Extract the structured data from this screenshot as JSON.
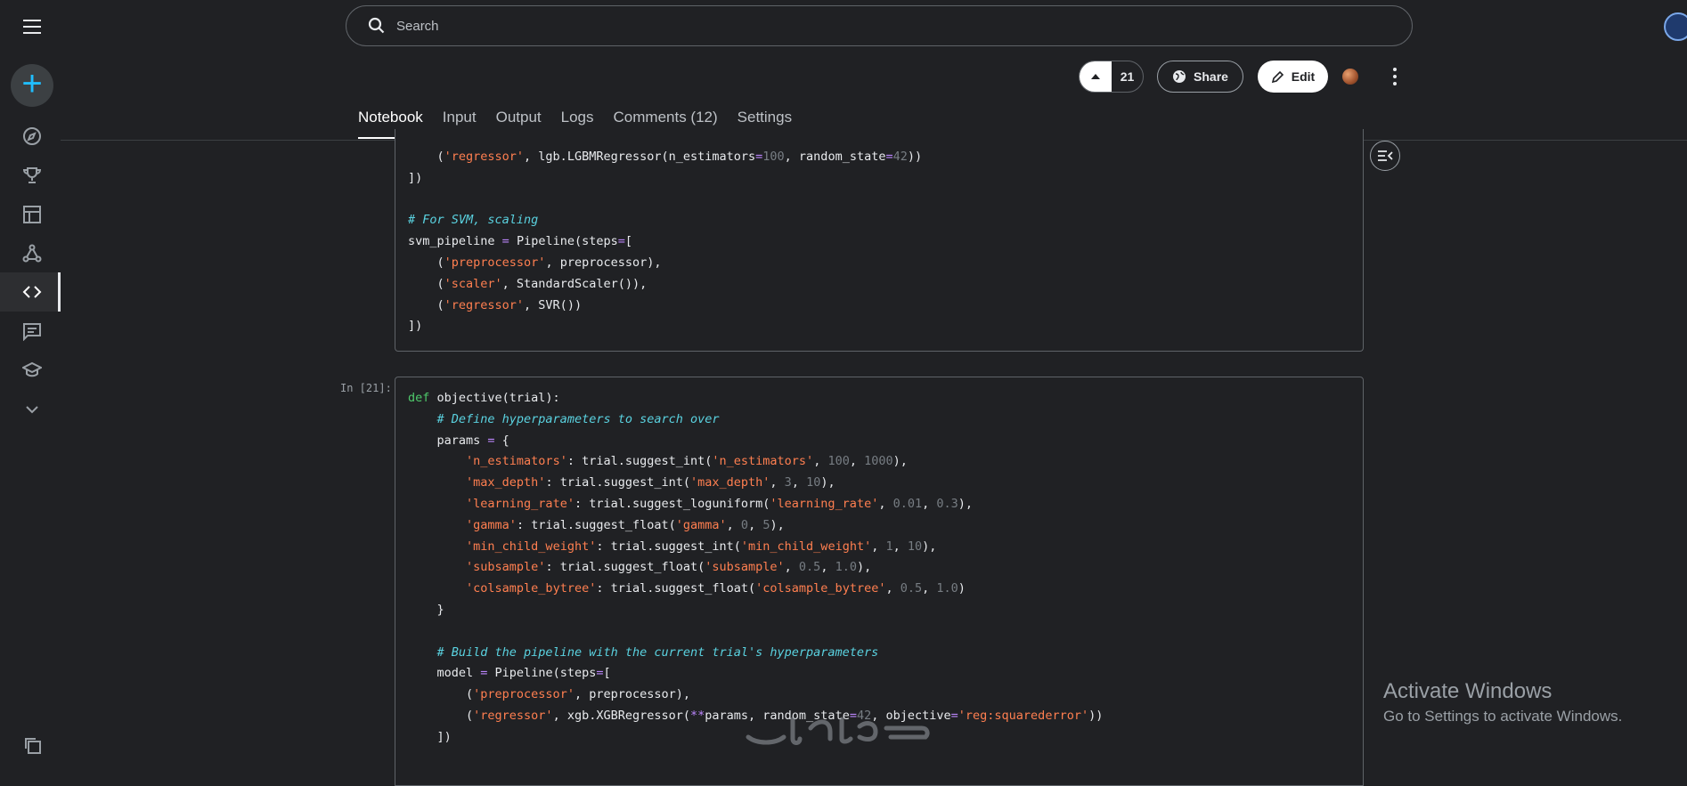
{
  "search": {
    "placeholder": "Search"
  },
  "header": {
    "vote_count": "21",
    "share_label": "Share",
    "edit_label": "Edit"
  },
  "tabs": [
    {
      "label": "Notebook",
      "active": true
    },
    {
      "label": "Input"
    },
    {
      "label": "Output"
    },
    {
      "label": "Logs"
    },
    {
      "label": "Comments (12)"
    },
    {
      "label": "Settings"
    }
  ],
  "sidebar": {
    "icons": [
      "menu-icon",
      "create-icon",
      "compass-icon",
      "trophy-icon",
      "table-icon",
      "models-icon",
      "code-icon",
      "discussion-icon",
      "learn-icon",
      "chevron-down-icon",
      "copy-icon"
    ],
    "active": "code-icon"
  },
  "cells": [
    {
      "prompt": "",
      "lines": [
        "    ('regressor', lgb.LGBMRegressor(n_estimators=100, random_state=42))",
        "])",
        "",
        "# For SVM, scaling",
        "svm_pipeline = Pipeline(steps=[",
        "    ('preprocessor', preprocessor),",
        "    ('scaler', StandardScaler()),",
        "    ('regressor', SVR())",
        "])"
      ]
    },
    {
      "prompt": "In [21]:",
      "lines": [
        "def objective(trial):",
        "    # Define hyperparameters to search over",
        "    params = {",
        "        'n_estimators': trial.suggest_int('n_estimators', 100, 1000),",
        "        'max_depth': trial.suggest_int('max_depth', 3, 10),",
        "        'learning_rate': trial.suggest_loguniform('learning_rate', 0.01, 0.3),",
        "        'gamma': trial.suggest_float('gamma', 0, 5),",
        "        'min_child_weight': trial.suggest_int('min_child_weight', 1, 10),",
        "        'subsample': trial.suggest_float('subsample', 0.5, 1.0),",
        "        'colsample_bytree': trial.suggest_float('colsample_bytree', 0.5, 1.0)",
        "    }",
        "",
        "    # Build the pipeline with the current trial's hyperparameters",
        "    model = Pipeline(steps=[",
        "        ('preprocessor', preprocessor),",
        "        ('regressor', xgb.XGBRegressor(**params, random_state=42, objective='reg:squarederror'))",
        "    ])"
      ]
    }
  ],
  "windows_watermark": {
    "title": "Activate Windows",
    "subtitle": "Go to Settings to activate Windows."
  },
  "colors": {
    "background": "#202124",
    "accent": "#20beff",
    "keyword": "#4ec96b",
    "string": "#ff7f50",
    "comment": "#5ad2e0",
    "number": "#777d83",
    "operator": "#bb86fc"
  }
}
